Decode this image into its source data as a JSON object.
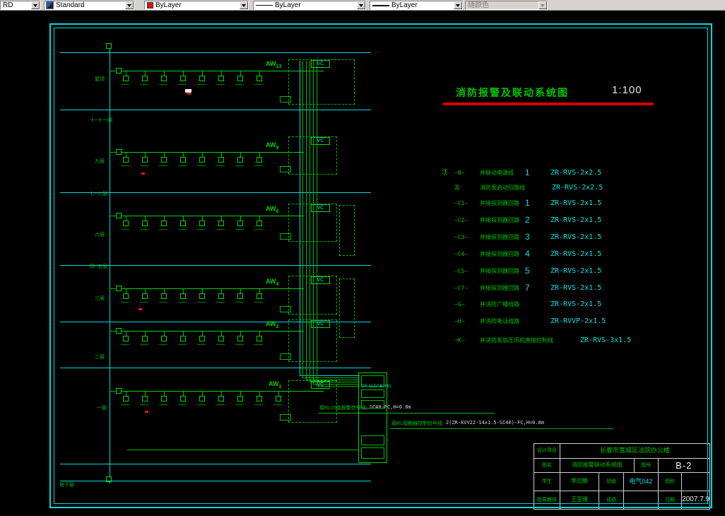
{
  "app": {
    "toolbar": {
      "combos": [
        {
          "label": "RD"
        },
        {
          "label": "Standard"
        },
        {
          "label": "ByLayer"
        },
        {
          "label": "ByLayer"
        },
        {
          "label": "ByLayer"
        },
        {
          "label": "随颜色"
        }
      ]
    }
  },
  "drawing": {
    "title": "消防报警及联动系统图",
    "scale": "1:100",
    "floor_labels": [
      "屋顶",
      "十~十一层",
      "九层",
      "七~八层",
      "六层",
      "四~五层",
      "三层",
      "二层",
      "一层",
      "地下层"
    ],
    "buses": [
      {
        "label": "AW",
        "sub": "13"
      },
      {
        "label": "AW",
        "sub": "9"
      },
      {
        "label": "AW",
        "sub": "6"
      },
      {
        "label": "AW",
        "sub": "4"
      },
      {
        "label": "AW",
        "sub": "2"
      },
      {
        "label": "AW",
        "sub": "1"
      }
    ],
    "vc_box_label": "VC",
    "panel_label": "DF-11Z/AB2HU",
    "annotations": [
      {
        "label": "接RL15路报警信号线",
        "spec": "SC40-FC,H=0.8m"
      },
      {
        "label": "接RL接触器控制信号线",
        "spec": "2(ZR-KVV22-14x1.5-SC40)-FC,H=0.8m"
      }
    ],
    "legend": {
      "note": "注",
      "rows": [
        {
          "sym": "—B—",
          "label": "并联动电源线",
          "num": "1",
          "spec": "ZR-RVS-2x2.5"
        },
        {
          "sym": "及",
          "label": "消防泵启动回路线",
          "num": "",
          "spec": "ZR-RVS-2x2.5"
        },
        {
          "sym": "—C1—",
          "label": "并接探测器回路",
          "num": "1",
          "spec": "ZR-RVS-2x1.5"
        },
        {
          "sym": "—C2—",
          "label": "并接探测器回路",
          "num": "2",
          "spec": "ZR-RVS-2x1.5"
        },
        {
          "sym": "—C3—",
          "label": "并接探测器回路",
          "num": "3",
          "spec": "ZR-RVS-2x1.5"
        },
        {
          "sym": "—C4—",
          "label": "并接探测器回路",
          "num": "4",
          "spec": "ZR-RVS-2x1.5"
        },
        {
          "sym": "—C5—",
          "label": "并接探测器回路",
          "num": "5",
          "spec": "ZR-RVS-2x1.5"
        },
        {
          "sym": "—C7—",
          "label": "并接探测器回路",
          "num": "7",
          "spec": "ZR-RVS-2x1.5"
        },
        {
          "sym": "—G—",
          "label": "并消防广播线路",
          "num": "",
          "spec": "ZR-RVS-2x1.5"
        },
        {
          "sym": "—H—",
          "label": "并消防电话线路",
          "num": "",
          "spec": "ZR-RVVP-2x1.5"
        },
        {
          "sym": "—K—",
          "label": "并消防泵加压风机直接控制线",
          "num": "",
          "spec": "ZR-RVS-3x1.5"
        }
      ]
    },
    "titleblock": {
      "project_label": "设计项目",
      "project": "长春市宽城区法院办公楼",
      "name_label": "图名",
      "name": "消防报警联动系统图",
      "no_label": "图号",
      "no": "B-2",
      "student_label": "学生",
      "student": "李应鹏",
      "class_label": "班级",
      "class": "电气042",
      "type_label": "图别",
      "type": "",
      "teacher_label": "指导教师",
      "teacher": "王亚珊",
      "grade_label": "成绩",
      "grade": "",
      "date_label": "日期",
      "date": "2007.7.9"
    }
  },
  "colors": {
    "cyan": "#00d8d8",
    "green": "#00b800",
    "green_bright": "#00d400",
    "red": "#e81414",
    "title_red": "#d40000"
  }
}
